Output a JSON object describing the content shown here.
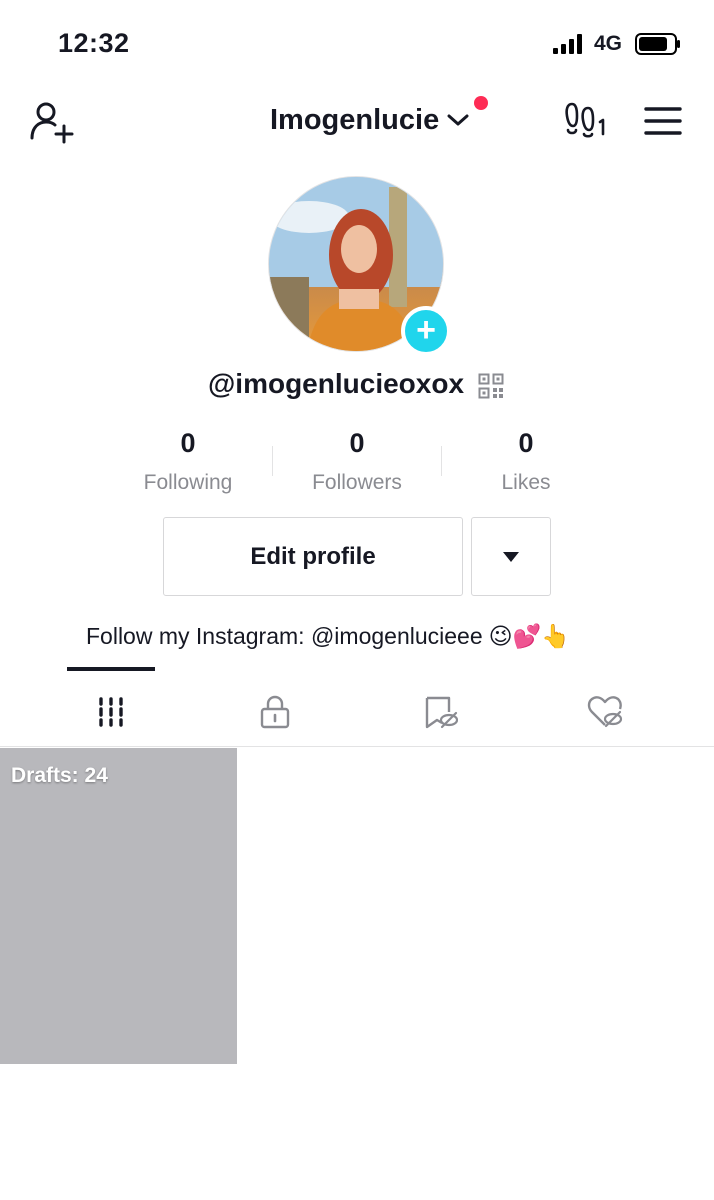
{
  "status_bar": {
    "time": "12:32",
    "network": "4G"
  },
  "header": {
    "account_name": "Imogenlucie",
    "notification_color": "#fe2c55",
    "icons": [
      "add-friend-icon",
      "chevron-down-icon",
      "footprint-icon",
      "menu-icon"
    ]
  },
  "profile": {
    "username": "@imogenlucieoxox",
    "avatar_add_color": "#20d5ec",
    "stats": [
      {
        "count": "0",
        "label": "Following"
      },
      {
        "count": "0",
        "label": "Followers"
      },
      {
        "count": "0",
        "label": "Likes"
      }
    ],
    "edit_profile_label": "Edit profile",
    "bio": "Follow my Instagram: @imogenlucieee",
    "bio_emoji": "😉💕👆"
  },
  "tabs": [
    {
      "name": "videos",
      "icon": "grid-icon",
      "active": true
    },
    {
      "name": "private",
      "icon": "lock-icon",
      "active": false
    },
    {
      "name": "favorites",
      "icon": "bookmark-hidden-icon",
      "active": false
    },
    {
      "name": "liked",
      "icon": "heart-hidden-icon",
      "active": false
    }
  ],
  "grid": {
    "drafts_label": "Drafts: 24"
  }
}
